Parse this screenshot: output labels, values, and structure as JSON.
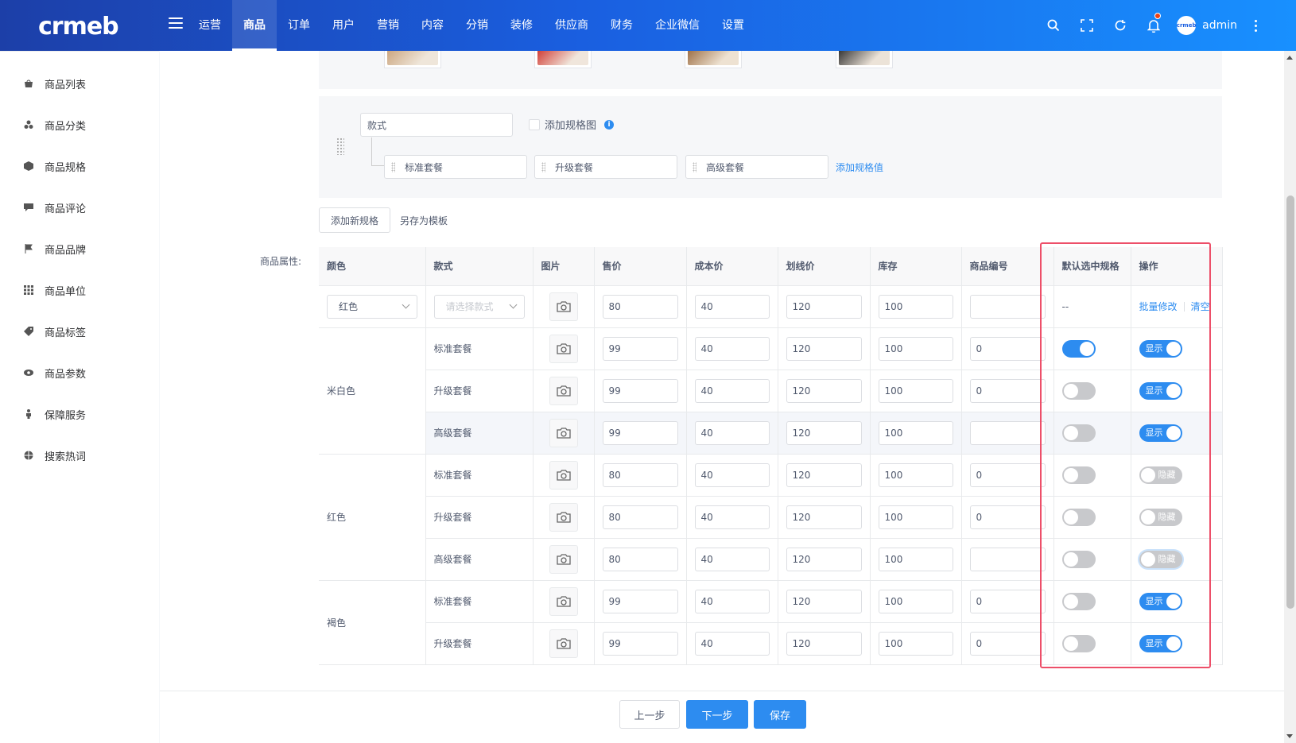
{
  "header": {
    "logo_text": "crmeb",
    "nav": [
      "运营",
      "商品",
      "订单",
      "用户",
      "营销",
      "内容",
      "分销",
      "装修",
      "供应商",
      "财务",
      "企业微信",
      "设置"
    ],
    "active_nav": "商品",
    "username": "admin",
    "avatar_text": "crmeb"
  },
  "sidebar": {
    "items": [
      {
        "label": "商品列表",
        "icon": "shop-icon"
      },
      {
        "label": "商品分类",
        "icon": "category-icon"
      },
      {
        "label": "商品规格",
        "icon": "box-icon"
      },
      {
        "label": "商品评论",
        "icon": "comment-icon"
      },
      {
        "label": "商品品牌",
        "icon": "flag-icon"
      },
      {
        "label": "商品单位",
        "icon": "grid-icon"
      },
      {
        "label": "商品标签",
        "icon": "tag-icon"
      },
      {
        "label": "商品参数",
        "icon": "eye-icon"
      },
      {
        "label": "保障服务",
        "icon": "person-icon"
      },
      {
        "label": "搜索热词",
        "icon": "globe-icon"
      }
    ]
  },
  "spec": {
    "name": "款式",
    "add_image_label": "添加规格图",
    "values": [
      "标准套餐",
      "升级套餐",
      "高级套餐"
    ],
    "add_value_label": "添加规格值"
  },
  "buttons": {
    "add_spec": "添加新规格",
    "save_template": "另存为模板",
    "prev": "上一步",
    "next": "下一步",
    "save": "保存"
  },
  "table": {
    "label": "商品属性:",
    "headers": [
      "颜色",
      "款式",
      "图片",
      "售价",
      "成本价",
      "划线价",
      "库存",
      "商品编号",
      "默认选中规格",
      "操作"
    ],
    "batch": {
      "color": "红色",
      "style_placeholder": "请选择款式",
      "price": "80",
      "cost": "40",
      "original": "120",
      "stock": "100",
      "code": "",
      "default": "--",
      "batch_edit": "批量修改",
      "clear": "清空"
    },
    "groups": [
      {
        "color": "米白色",
        "rows": [
          {
            "style": "标准套餐",
            "price": "99",
            "cost": "40",
            "original": "120",
            "stock": "100",
            "code": "0",
            "default_on": true,
            "show": true,
            "show_label": "显示"
          },
          {
            "style": "升级套餐",
            "price": "99",
            "cost": "40",
            "original": "120",
            "stock": "100",
            "code": "0",
            "default_on": false,
            "show": true,
            "show_label": "显示"
          },
          {
            "style": "高级套餐",
            "price": "99",
            "cost": "40",
            "original": "120",
            "stock": "100",
            "code": "",
            "default_on": false,
            "show": true,
            "show_label": "显示"
          }
        ]
      },
      {
        "color": "红色",
        "rows": [
          {
            "style": "标准套餐",
            "price": "80",
            "cost": "40",
            "original": "120",
            "stock": "100",
            "code": "0",
            "default_on": false,
            "show": false,
            "show_label": "隐藏"
          },
          {
            "style": "升级套餐",
            "price": "80",
            "cost": "40",
            "original": "120",
            "stock": "100",
            "code": "0",
            "default_on": false,
            "show": false,
            "show_label": "隐藏"
          },
          {
            "style": "高级套餐",
            "price": "80",
            "cost": "40",
            "original": "120",
            "stock": "100",
            "code": "",
            "default_on": false,
            "show": false,
            "show_label": "隐藏"
          }
        ]
      },
      {
        "color": "褐色",
        "rows": [
          {
            "style": "标准套餐",
            "price": "99",
            "cost": "40",
            "original": "120",
            "stock": "100",
            "code": "0",
            "default_on": false,
            "show": true,
            "show_label": "显示"
          },
          {
            "style": "升级套餐",
            "price": "99",
            "cost": "40",
            "original": "120",
            "stock": "100",
            "code": "0",
            "default_on": false,
            "show": true,
            "show_label": "显示"
          }
        ]
      }
    ]
  },
  "colors": {
    "accent": "#2d8cf0",
    "highlight_box": "#ed4f69",
    "header_start": "#1c3fa8",
    "header_end": "#1890ff"
  }
}
